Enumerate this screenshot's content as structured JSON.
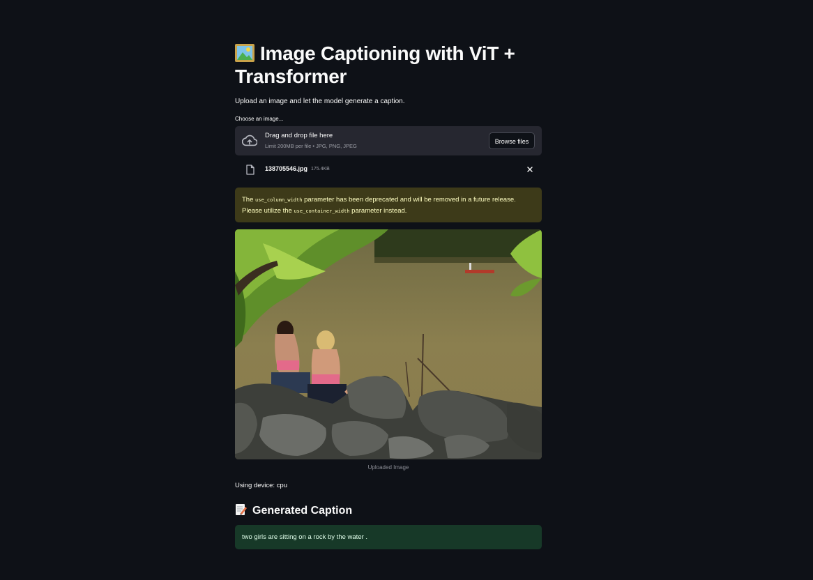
{
  "header": {
    "title": "Image Captioning with ViT + Transformer",
    "title_icon": "framed-picture-icon",
    "subtitle": "Upload an image and let the model generate a caption."
  },
  "uploader": {
    "label": "Choose an image...",
    "drop_text": "Drag and drop file here",
    "limit_text": "Limit 200MB per file • JPG, PNG, JPEG",
    "browse_label": "Browse files",
    "file": {
      "name": "138705546.jpg",
      "size": "175.4KB"
    }
  },
  "warning": {
    "pre": "The ",
    "code1": "use_column_width",
    "mid": " parameter has been deprecated and will be removed in a future release. Please utilize the ",
    "code2": "use_container_width",
    "post": " parameter instead."
  },
  "image": {
    "caption": "Uploaded Image"
  },
  "device_text": "Using device: cpu",
  "result": {
    "heading": "Generated Caption",
    "heading_icon": "memo-icon",
    "caption": "two girls are sitting on a rock by the water ."
  },
  "colors": {
    "background": "#0e1117",
    "warning_bg": "#3d3a19",
    "success_bg": "#173928"
  }
}
